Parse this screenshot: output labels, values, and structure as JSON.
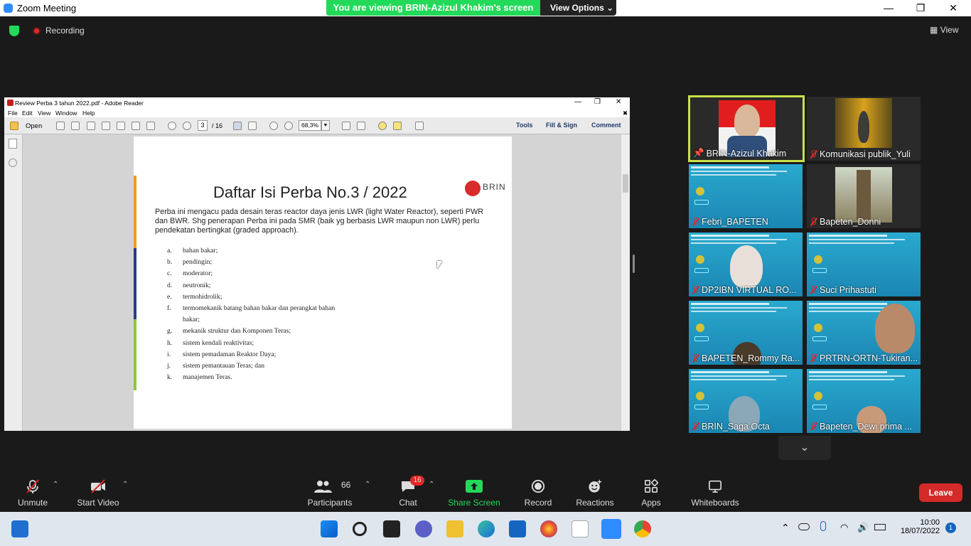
{
  "window": {
    "title": "Zoom Meeting"
  },
  "share_banner": {
    "text": "You are viewing BRIN-Azizul Khakim's screen",
    "view_options": "View Options"
  },
  "topbar": {
    "recording": "Recording",
    "view": "View"
  },
  "reader": {
    "title": "Review Perba 3 tahun 2022.pdf - Adobe Reader",
    "menu": [
      "File",
      "Edit",
      "View",
      "Window",
      "Help"
    ],
    "open_label": "Open",
    "page_current": "3",
    "page_total": "/ 16",
    "zoom": "68,3%",
    "links": [
      "Tools",
      "Fill & Sign",
      "Comment"
    ]
  },
  "document": {
    "title": "Daftar Isi Perba No.3 / 2022",
    "logo_text": "BRIN",
    "paragraph": "Perba ini mengacu pada desain teras reactor daya jenis LWR (light Water Reactor), seperti PWR dan BWR. Shg penerapan Perba ini pada SMR (baik yg berbasis LWR maupun non LWR) perlu pendekatan bertingkat (graded approach).",
    "items": [
      {
        "letter": "a.",
        "text": "bahan bakar;"
      },
      {
        "letter": "b.",
        "text": "pendingin;"
      },
      {
        "letter": "c.",
        "text": "moderator;"
      },
      {
        "letter": "d.",
        "text": "neutronik;"
      },
      {
        "letter": "e.",
        "text": "termohidrolik;"
      },
      {
        "letter": "f.",
        "text": "termomekanik batang bahan bakar dan perangkat bahan"
      },
      {
        "letter": "",
        "text": "bakar;"
      },
      {
        "letter": "g.",
        "text": "mekanik struktur dan Komponen Teras;"
      },
      {
        "letter": "h.",
        "text": "sistem kendali reaktivitas;"
      },
      {
        "letter": "i.",
        "text": "sistem pemadaman Reaktor Daya;"
      },
      {
        "letter": "j.",
        "text": "sistem pemantauan Teras; dan"
      },
      {
        "letter": "k.",
        "text": "manajemen Teras."
      }
    ]
  },
  "participants_gallery": [
    "BRIN-Azizul Khakim",
    "Komunikasi publik_Yuli",
    "Febri_BAPETEN",
    "Bapeten_Donni",
    "DP2IBN VIRTUAL RO...",
    "Suci Prihastuti",
    "BAPETEN_Rommy Ra...",
    "PRTRN-ORTN-Tukiran...",
    "BRIN_Saga Octa",
    "Bapeten_Dewi prima ..."
  ],
  "controls": {
    "unmute": "Unmute",
    "start_video": "Start Video",
    "participants": "Participants",
    "participants_count": "66",
    "chat": "Chat",
    "chat_badge": "16",
    "share_screen": "Share Screen",
    "record": "Record",
    "reactions": "Reactions",
    "apps": "Apps",
    "whiteboards": "Whiteboards",
    "leave": "Leave"
  },
  "taskbar": {
    "time": "10:00",
    "date": "18/07/2022",
    "notifications": "1"
  },
  "colors": {
    "zoom_blue": "#2d8cff",
    "share_green": "#23d959",
    "leave_red": "#d42a2a",
    "active_speaker": "#c8e04a"
  }
}
